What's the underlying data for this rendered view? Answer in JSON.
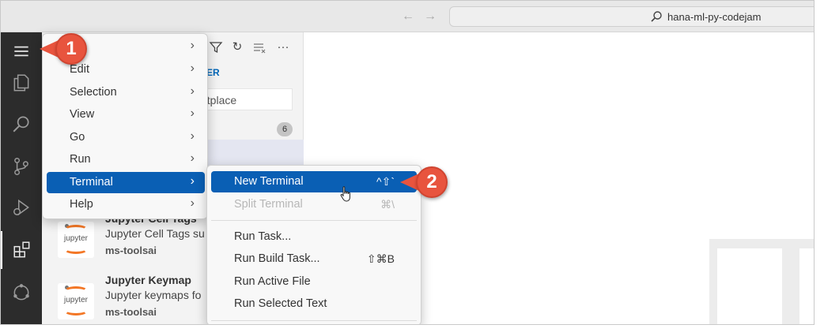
{
  "titlebar": {
    "back_icon": "arrow-left",
    "forward_icon": "arrow-right",
    "search_text": "hana-ml-py-codejam"
  },
  "activity_bar": {
    "items": [
      "menu",
      "explorer",
      "search",
      "source-control",
      "run-debug",
      "extensions",
      "remote"
    ]
  },
  "sidebar": {
    "toolbar_icons": [
      "filter-icon",
      "refresh-icon",
      "clear-icon",
      "more-icon"
    ],
    "link_fragment": "ER",
    "search_fragment": "etplace",
    "badge_count": "6",
    "extensions": [
      {
        "name": "Jupyter Cell Tags",
        "description": "Jupyter Cell Tags su",
        "publisher": "ms-toolsai",
        "logo_text": "jupyter"
      },
      {
        "name": "Jupyter Keymap",
        "description": "Jupyter keymaps fo",
        "publisher": "ms-toolsai",
        "logo_text": "jupyter"
      }
    ]
  },
  "main_menu": {
    "items": [
      {
        "label": "",
        "has_submenu": true
      },
      {
        "label": "Edit",
        "has_submenu": true
      },
      {
        "label": "Selection",
        "has_submenu": true
      },
      {
        "label": "View",
        "has_submenu": true
      },
      {
        "label": "Go",
        "has_submenu": true
      },
      {
        "label": "Run",
        "has_submenu": true
      },
      {
        "label": "Terminal",
        "has_submenu": true,
        "selected": true
      },
      {
        "label": "Help",
        "has_submenu": true
      }
    ]
  },
  "terminal_submenu": {
    "items": [
      {
        "label": "New Terminal",
        "shortcut": "^⇧`",
        "selected": true
      },
      {
        "label": "Split Terminal",
        "shortcut": "⌘\\",
        "disabled": true
      },
      {
        "label": "Run Task...",
        "shortcut": ""
      },
      {
        "label": "Run Build Task...",
        "shortcut": "⇧⌘B"
      },
      {
        "label": "Run Active File",
        "shortcut": ""
      },
      {
        "label": "Run Selected Text",
        "shortcut": ""
      }
    ]
  },
  "callouts": {
    "one": "1",
    "two": "2"
  },
  "colors": {
    "accent": "#0a5fb4",
    "callout": "#e8543e",
    "activity_bar": "#2c2c2c"
  }
}
